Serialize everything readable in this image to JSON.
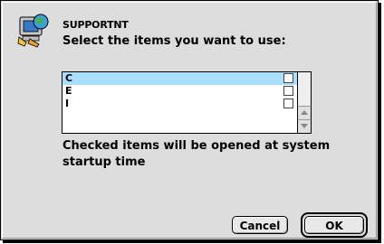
{
  "dialog": {
    "app_name": "SUPPORTNT",
    "prompt": "Select the items you want to use:",
    "hint": "Checked items will be opened at system startup time",
    "icon": "support-app-icon"
  },
  "list": {
    "items": [
      {
        "label": "C",
        "checked": false,
        "selected": true
      },
      {
        "label": "E",
        "checked": false,
        "selected": false
      },
      {
        "label": "I",
        "checked": false,
        "selected": false
      }
    ],
    "selected_color": "#aadfff"
  },
  "buttons": {
    "cancel_label": "Cancel",
    "ok_label": "OK"
  }
}
